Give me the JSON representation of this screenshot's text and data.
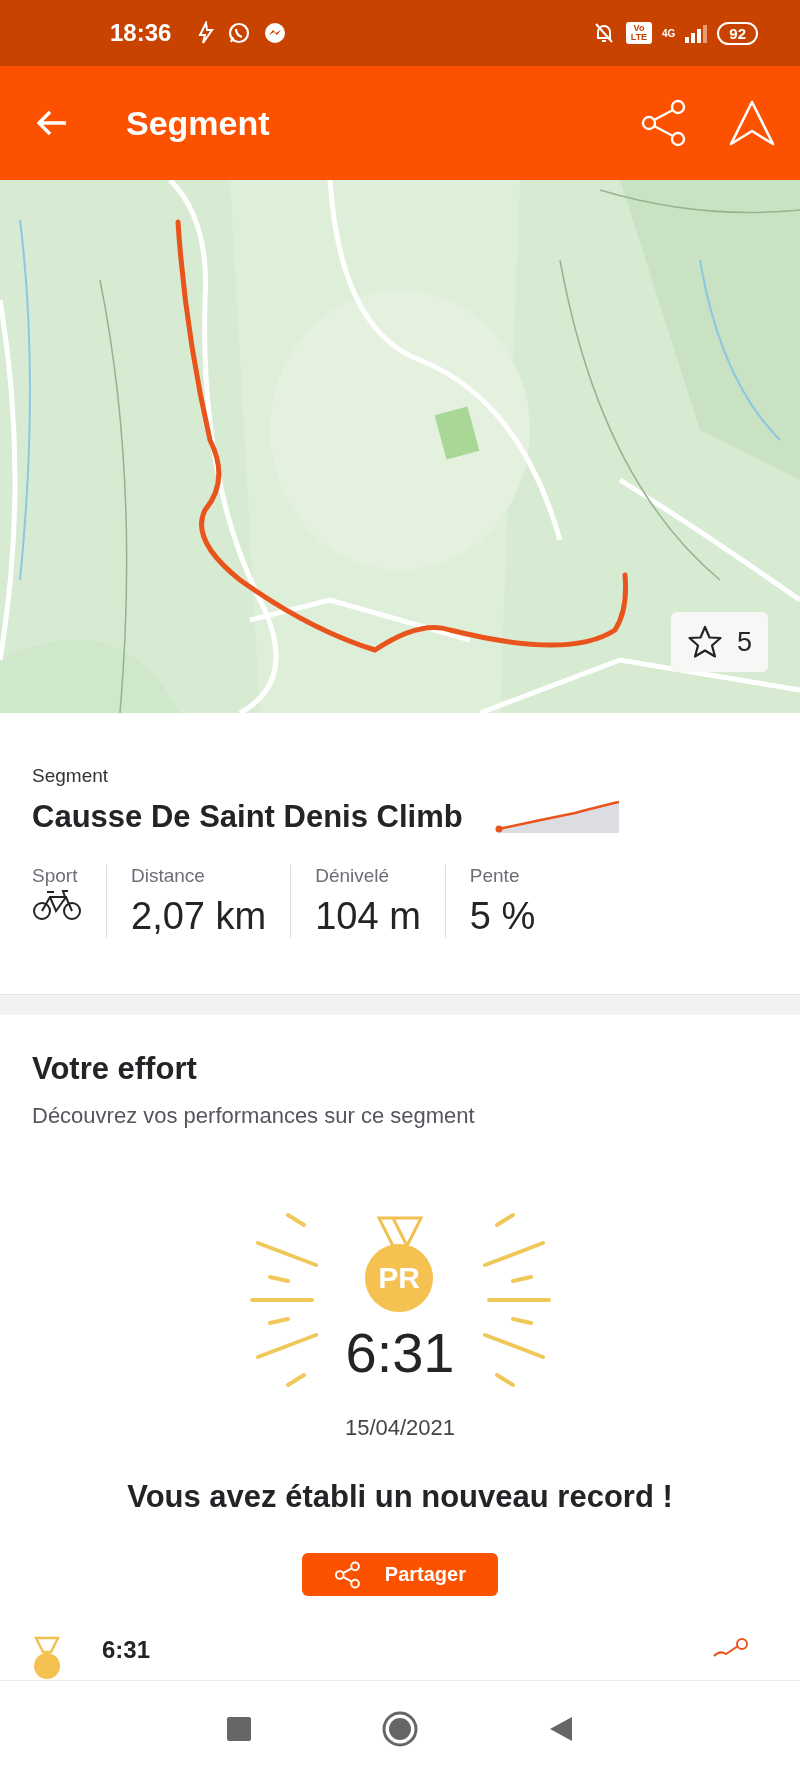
{
  "status_bar": {
    "time": "18:36",
    "network": "4G",
    "volte": "Vo LTE",
    "battery": "92"
  },
  "app_bar": {
    "title": "Segment"
  },
  "map": {
    "kind": "picture",
    "stars": "5"
  },
  "segment": {
    "label": "Segment",
    "name": "Causse De Saint Denis Climb",
    "stats": [
      {
        "label": "Sport",
        "kind": "bike"
      },
      {
        "label": "Distance",
        "kind": "text",
        "value": "2,07 km"
      },
      {
        "label": "Dénivelé",
        "kind": "text",
        "value": "104 m"
      },
      {
        "label": "Pente",
        "kind": "text",
        "value": "5 %"
      }
    ]
  },
  "effort": {
    "title": "Votre effort",
    "subtitle": "Découvrez vos performances sur ce segment",
    "pr": {
      "badge": "PR",
      "time": "6:31",
      "date": "15/04/2021"
    },
    "message": "Vous avez établi un nouveau record !",
    "share_button": "Partager",
    "rows": [
      {
        "time": "6:31"
      }
    ]
  }
}
